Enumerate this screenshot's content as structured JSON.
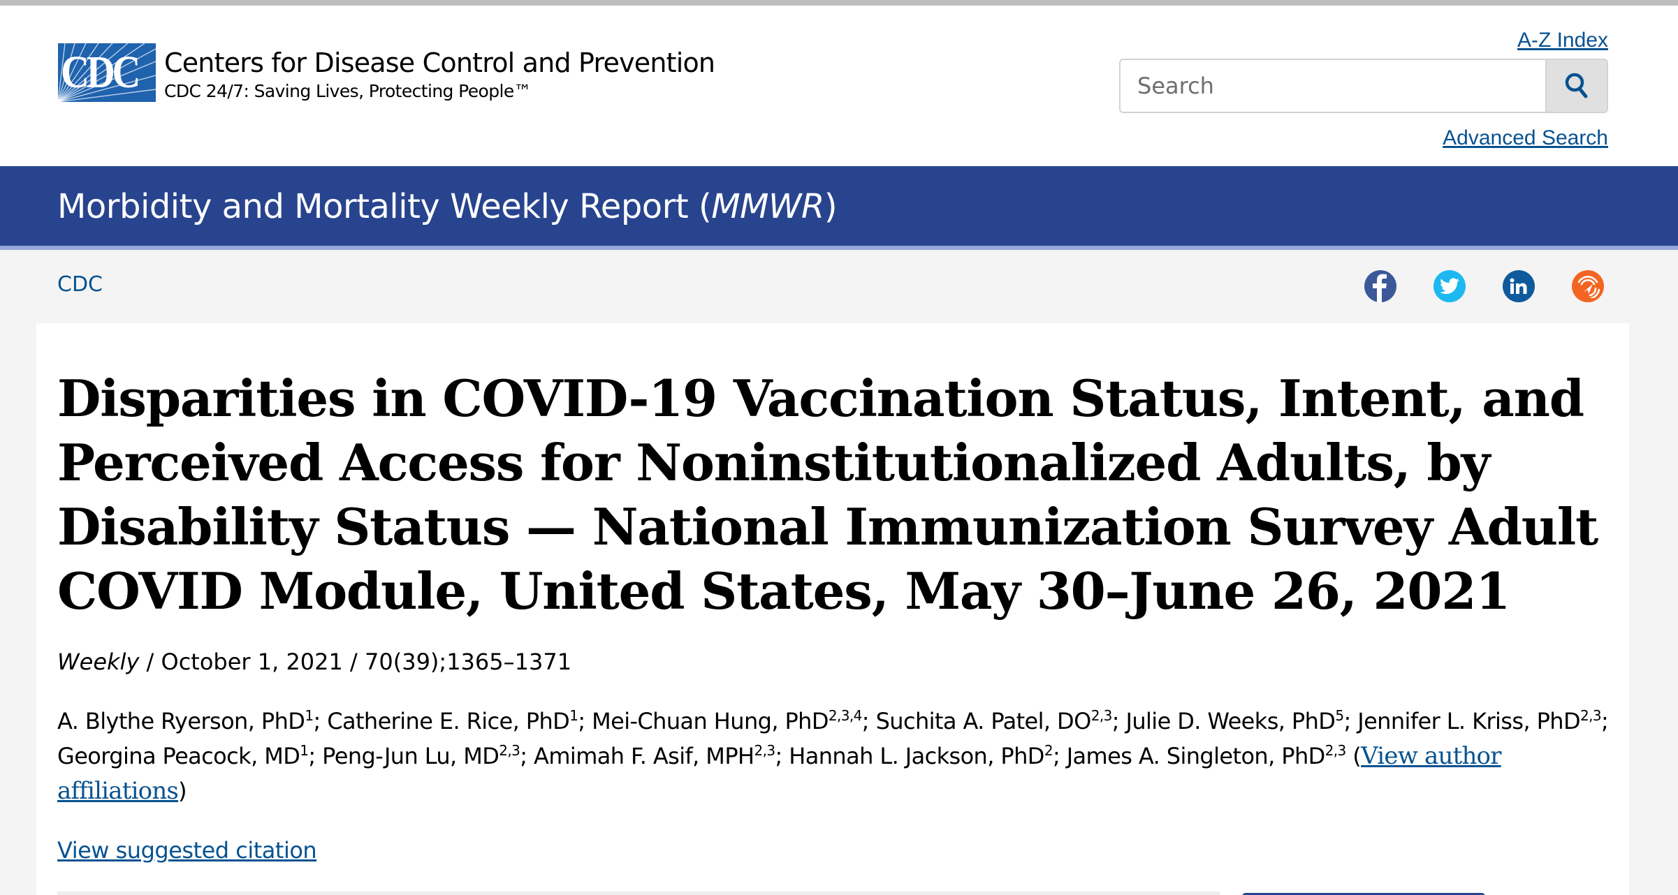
{
  "header": {
    "logo_letters": "CDC",
    "org_name": "Centers for Disease Control and Prevention",
    "tagline": "CDC 24/7: Saving Lives, Protecting People™",
    "az_index_label": "A-Z Index",
    "search_placeholder": "Search",
    "search_value": "",
    "advanced_search_label": "Advanced Search"
  },
  "banner": {
    "title_prefix": "Morbidity and Mortality Weekly Report (",
    "title_italic": "MMWR",
    "title_suffix": ")"
  },
  "breadcrumb": {
    "items": [
      "CDC"
    ]
  },
  "social": [
    {
      "name": "facebook",
      "color": "#3b5998"
    },
    {
      "name": "twitter",
      "color": "#1da1f2"
    },
    {
      "name": "linkedin",
      "color": "#0e5a9c"
    },
    {
      "name": "syndication",
      "color": "#f26522"
    }
  ],
  "article": {
    "title": "Disparities in COVID-19 Vaccination Status, Intent, and Perceived Access for Noninstitutionalized Adults, by Disability Status — National Immunization Survey Adult COVID Module, United States, May 30–June 26, 2021",
    "meta_series": "Weekly",
    "meta_rest": " / October 1, 2021 / 70(39);1365–1371",
    "authors": [
      {
        "name": "A. Blythe Ryerson, PhD",
        "aff": "1"
      },
      {
        "name": "Catherine E. Rice, PhD",
        "aff": "1"
      },
      {
        "name": "Mei-Chuan Hung, PhD",
        "aff": "2,3,4"
      },
      {
        "name": "Suchita A. Patel, DO",
        "aff": "2,3"
      },
      {
        "name": "Julie D. Weeks, PhD",
        "aff": "5"
      },
      {
        "name": "Jennifer L. Kriss, PhD",
        "aff": "2,3"
      },
      {
        "name": "Georgina Peacock, MD",
        "aff": "1"
      },
      {
        "name": "Peng-Jun Lu, MD",
        "aff": "2,3"
      },
      {
        "name": "Amimah F. Asif, MPH",
        "aff": "2,3"
      },
      {
        "name": "Hannah L. Jackson, PhD",
        "aff": "2"
      },
      {
        "name": "James A. Singleton, PhD",
        "aff": "2,3"
      }
    ],
    "affiliations_link": "View author affiliations",
    "citation_link": "View suggested citation"
  }
}
